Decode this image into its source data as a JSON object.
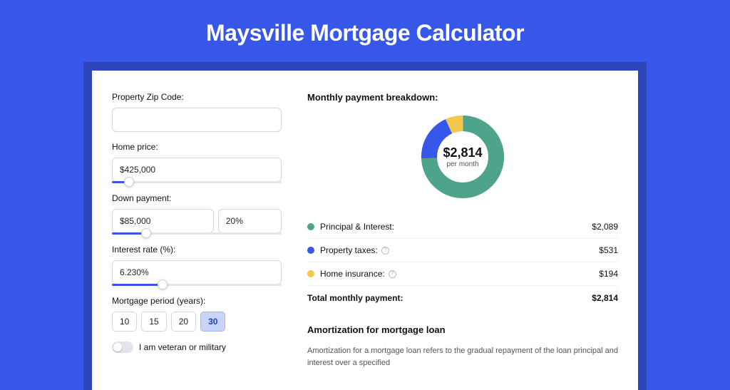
{
  "page": {
    "title": "Maysville Mortgage Calculator"
  },
  "form": {
    "zip": {
      "label": "Property Zip Code:",
      "value": ""
    },
    "home_price": {
      "label": "Home price:",
      "value": "$425,000",
      "slider_pct": 10
    },
    "down_payment": {
      "label": "Down payment:",
      "value": "$85,000",
      "pct_value": "20%",
      "slider_pct": 20
    },
    "interest_rate": {
      "label": "Interest rate (%):",
      "value": "6.230%",
      "slider_pct": 30
    },
    "mortgage_period": {
      "label": "Mortgage period (years):",
      "options": [
        "10",
        "15",
        "20",
        "30"
      ],
      "active": "30"
    },
    "veteran_toggle": {
      "label": "I am veteran or military",
      "on": false
    }
  },
  "breakdown": {
    "title": "Monthly payment breakdown:",
    "donut": {
      "value": "$2,814",
      "label": "per month"
    },
    "items": [
      {
        "name": "Principal & Interest:",
        "value": "$2,089",
        "color": "#4ea48a",
        "info": false,
        "pct": 74.2
      },
      {
        "name": "Property taxes:",
        "value": "$531",
        "color": "#3657e8",
        "info": true,
        "pct": 18.9
      },
      {
        "name": "Home insurance:",
        "value": "$194",
        "color": "#f2c94c",
        "info": true,
        "pct": 6.9
      }
    ],
    "total": {
      "name": "Total monthly payment:",
      "value": "$2,814"
    }
  },
  "amortization": {
    "title": "Amortization for mortgage loan",
    "text": "Amortization for a mortgage loan refers to the gradual repayment of the loan principal and interest over a specified"
  },
  "chart_data": {
    "type": "pie",
    "title": "Monthly payment breakdown",
    "series": [
      {
        "name": "Principal & Interest",
        "value": 2089,
        "color": "#4ea48a"
      },
      {
        "name": "Property taxes",
        "value": 531,
        "color": "#3657e8"
      },
      {
        "name": "Home insurance",
        "value": 194,
        "color": "#f2c94c"
      }
    ],
    "total": 2814,
    "center_label": "$2,814 per month"
  }
}
